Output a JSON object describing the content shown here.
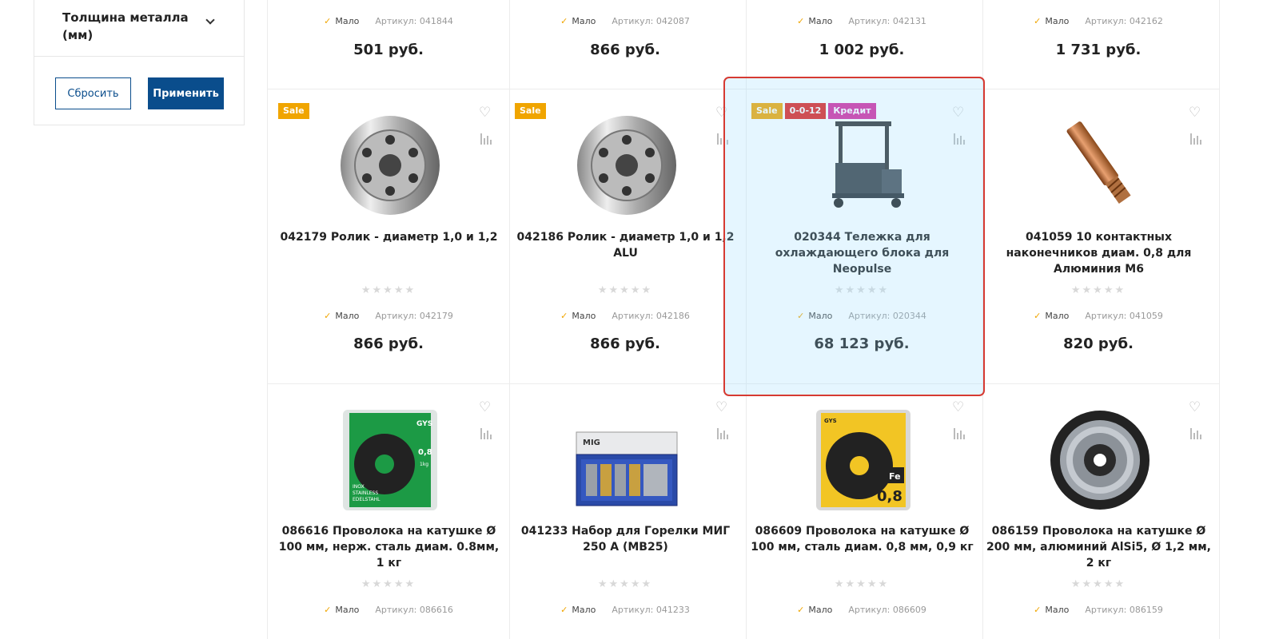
{
  "filter": {
    "title": "Толщина металла (мм)",
    "reset_label": "Сбросить",
    "apply_label": "Применить"
  },
  "row1": [
    {
      "stock": "Мало",
      "article": "Артикул: 041844",
      "price": "501 руб."
    },
    {
      "stock": "Мало",
      "article": "Артикул: 042087",
      "price": "866 руб."
    },
    {
      "stock": "Мало",
      "article": "Артикул: 042131",
      "price": "1 002 руб."
    },
    {
      "stock": "Мало",
      "article": "Артикул: 042162",
      "price": "1 731 руб."
    }
  ],
  "row2": [
    {
      "badges": [
        "Sale"
      ],
      "name": "042179 Ролик - диаметр 1,0 и 1,2",
      "stock": "Мало",
      "article": "Артикул: 042179",
      "price": "866 руб.",
      "image": "roller"
    },
    {
      "badges": [
        "Sale"
      ],
      "name": "042186 Ролик - диаметр 1,0 и 1,2 ALU",
      "stock": "Мало",
      "article": "Артикул: 042186",
      "price": "866 руб.",
      "image": "roller"
    },
    {
      "badges": [
        "Sale",
        "0-0-12",
        "Кредит"
      ],
      "name": "020344 Тележка для охлаждающего блока для Neopulse",
      "stock": "Мало",
      "article": "Артикул: 020344",
      "price": "68 123 руб.",
      "image": "cart"
    },
    {
      "badges": [],
      "name": "041059 10 контактных наконечников диам. 0,8 для Алюминия M6",
      "stock": "Мало",
      "article": "Артикул: 041059",
      "price": "820 руб.",
      "image": "tip"
    }
  ],
  "row3": [
    {
      "name": "086616 Проволока на катушке Ø 100 мм, нерж. сталь диам. 0.8мм, 1 кг",
      "stock": "Мало",
      "article": "Артикул: 086616",
      "image": "green-spool"
    },
    {
      "name": "041233 Набор для Горелки МИГ 250 А (MB25)",
      "stock": "Мало",
      "article": "Артикул: 041233",
      "image": "kit"
    },
    {
      "name": "086609 Проволока на катушке Ø 100 мм, сталь диам. 0,8 мм, 0,9 кг",
      "stock": "Мало",
      "article": "Артикул: 086609",
      "image": "yellow-spool"
    },
    {
      "name": "086159 Проволока на катушке Ø 200 мм, алюминий AlSi5, Ø 1,2 мм, 2 кг",
      "stock": "Мало",
      "article": "Артикул: 086159",
      "image": "wire-spool"
    }
  ],
  "image_text": {
    "green_brand": "GYS",
    "green_size": "0,8",
    "green_weight": "1kg",
    "green_line1": "INOX",
    "green_line2": "STAINLESS",
    "green_line3": "EDELSTAHL",
    "kit_brand": "MIG",
    "yellow_brand": "GYS",
    "yellow_fe": "Fe",
    "yellow_size": "0,8"
  },
  "stars": "★★★★★",
  "colors": {
    "accent": "#0a4d8c",
    "sale": "#f0a500",
    "red": "#e0201c",
    "credit": "#d6289c",
    "highlight": "#d63a32"
  }
}
